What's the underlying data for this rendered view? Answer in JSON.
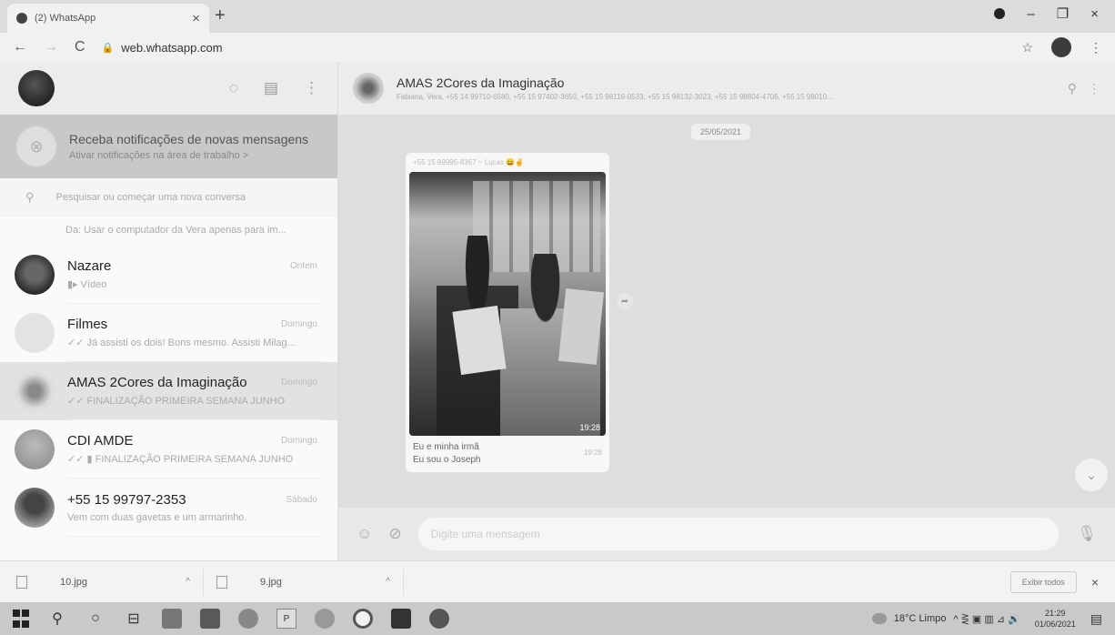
{
  "browser": {
    "tab_title": "(2) WhatsApp",
    "tab_close": "×",
    "new_tab": "+",
    "url": "web.whatsapp.com",
    "back": "←",
    "forward": "→",
    "reload": "C",
    "lock": "🔒",
    "star": "☆",
    "menu": "⋮",
    "window": {
      "minimize": "–",
      "restore": "❐",
      "close": "×"
    }
  },
  "sidebar": {
    "header_icons": {
      "status": "◌",
      "new_chat": "▤",
      "menu": "⋮"
    },
    "notification": {
      "title": "Receba notificações de novas mensagens",
      "subtitle": "Ativar notificações na área de trabalho >",
      "icon": "⊗"
    },
    "search_placeholder": "Pesquisar ou começar uma nova conversa",
    "search_icon": "⚲",
    "partial_preview": "Da: Usar o computador da Vera apenas para im...",
    "chats": [
      {
        "name": "Nazare",
        "time": "Ontem",
        "preview": "▮▸ Vídeo"
      },
      {
        "name": "Filmes",
        "time": "Domingo",
        "preview": "✓✓ Já assisti os dois! Bons mesmo. Assisti Milag..."
      },
      {
        "name": "AMAS 2Cores da Imaginação",
        "time": "Domingo",
        "preview": "✓✓ FINALIZAÇÃO PRIMEIRA SEMANA JUNHO"
      },
      {
        "name": "CDI AMDE",
        "time": "Domingo",
        "preview": "✓✓ ▮ FINALIZAÇÃO PRIMEIRA SEMANA JUNHO"
      },
      {
        "name": "+55 15 99797-2353",
        "time": "Sábado",
        "preview": "Vem com duas gavetas e um armarinho."
      }
    ]
  },
  "conversation": {
    "group_name": "AMAS 2Cores da Imaginação",
    "members": "Fabiana, Vera, +55 14 99710-6580, +55 15 97402-3650, +55 15 98116-0533, +55 15 98132-3023, +55 15 98804-4706, +55 15 98010...",
    "header_icons": {
      "search": "⚲",
      "menu": "⋮"
    },
    "date": "25/05/2021",
    "message": {
      "sender": "+55 15 99995-8357 ~ Lucas 😄✌",
      "photo_time": "19:28",
      "caption_line1": "Eu e minha irmã",
      "caption_line2": "Eu sou o Joseph",
      "caption_time": "19:28"
    },
    "forward_icon": "➦",
    "scroll_icon": "⌄",
    "composer": {
      "emoji_icon": "☺",
      "attach_icon": "⊘",
      "placeholder": "Digite uma mensagem",
      "mic_icon": "🎙"
    }
  },
  "downloads": {
    "items": [
      {
        "name": "10.jpg",
        "caret": "^"
      },
      {
        "name": "9.jpg",
        "caret": "^"
      }
    ],
    "show_all": "Exibir todos",
    "close": "×"
  },
  "taskbar": {
    "search_icon": "⚲",
    "cortana_icon": "○",
    "taskview_icon": "⊟",
    "weather": "18°C Limpo",
    "tray_icons": "^ ⋛ ▣ ▥ ⊿ 🔊",
    "time": "21:29",
    "date": "01/06/2021",
    "notify_icon": "▤"
  }
}
